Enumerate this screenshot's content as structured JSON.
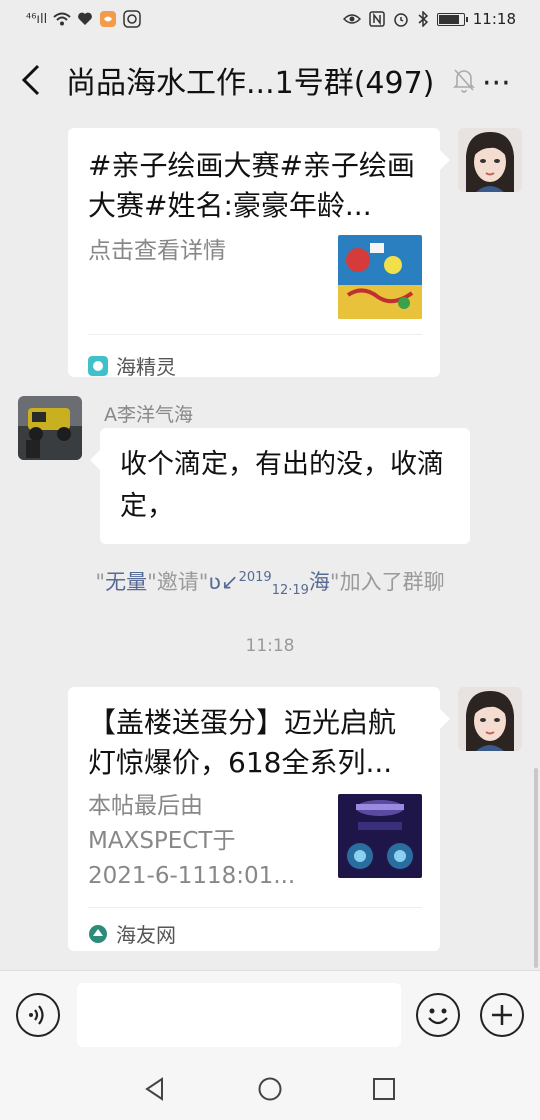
{
  "statusbar": {
    "signal": "⁴⁶ıll",
    "time": "11:18",
    "battery_level": 0.85
  },
  "header": {
    "title": "尚品海水工作...1号群(497)",
    "more": "···"
  },
  "messages": {
    "card1": {
      "title": "#亲子绘画大赛#亲子绘画大赛#姓名:豪豪年龄...",
      "desc": "点击查看详情",
      "source": "海精灵"
    },
    "msg2": {
      "sender": "A李洋气海",
      "text": "收个滴定，有出的没，收滴定，"
    },
    "system": {
      "q1": "\"",
      "user1": "无量",
      "q2": "\"邀请\"",
      "user2_prefix": "ʋ↙",
      "user2_year": "2019",
      "user2_date": "12·19",
      "user2_suffix": "海",
      "tail": "\"加入了群聊"
    },
    "time": "11:18",
    "card2": {
      "title": "【盖楼送蛋分】迈光启航灯惊爆价，618全系列...",
      "desc_line1": "本帖最后由",
      "desc_line2": "MAXSPECT于",
      "desc_line3": "2021-6-1118:01...",
      "source": "海友网"
    }
  },
  "colors": {
    "background": "#ededed",
    "link": "#576b95",
    "bubble": "#ffffff"
  }
}
